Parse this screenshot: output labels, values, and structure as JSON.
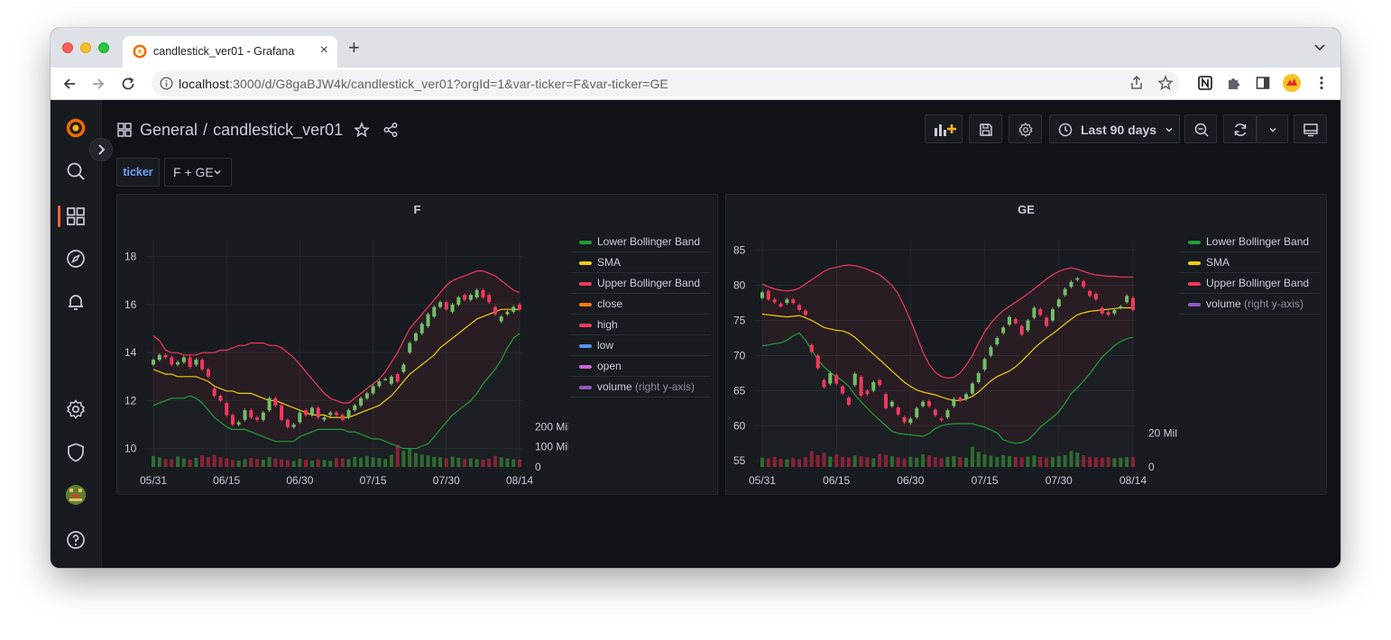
{
  "browser": {
    "tab_title": "candlestick_ver01 - Grafana",
    "url_host": "localhost",
    "url_rest": ":3000/d/G8gaBJW4k/candlestick_ver01?orgId=1&var-ticker=F&var-ticker=GE"
  },
  "dashboard": {
    "breadcrumb_folder": "General",
    "breadcrumb_separator": "/",
    "breadcrumb_title": "candlestick_ver01",
    "time_range": "Last 90 days",
    "variable_label": "ticker",
    "variable_value": "F + GE"
  },
  "colors": {
    "lower_band": "#1f9f3a",
    "sma": "#f2cc0c",
    "upper_band": "#f2385e",
    "close": "#ff780a",
    "high": "#f2385e",
    "low": "#5794f2",
    "open": "#c763d6",
    "volume": "#8f5bbf",
    "candle_up": "#73bf69",
    "candle_down": "#f2385e"
  },
  "panels": [
    {
      "title": "F",
      "legend": [
        {
          "label": "Lower Bollinger Band",
          "suffix": "",
          "color": "#1f9f3a"
        },
        {
          "label": "SMA",
          "suffix": "",
          "color": "#f2cc0c"
        },
        {
          "label": "Upper Bollinger Band",
          "suffix": "",
          "color": "#f2385e"
        },
        {
          "label": "close",
          "suffix": "",
          "color": "#ff780a"
        },
        {
          "label": "high",
          "suffix": "",
          "color": "#f2385e"
        },
        {
          "label": "low",
          "suffix": "",
          "color": "#5794f2"
        },
        {
          "label": "open",
          "suffix": "",
          "color": "#c763d6"
        },
        {
          "label": "volume",
          "suffix": " (right y-axis)",
          "color": "#8f5bbf"
        }
      ]
    },
    {
      "title": "GE",
      "legend": [
        {
          "label": "Lower Bollinger Band",
          "suffix": "",
          "color": "#1f9f3a"
        },
        {
          "label": "SMA",
          "suffix": "",
          "color": "#f2cc0c"
        },
        {
          "label": "Upper Bollinger Band",
          "suffix": "",
          "color": "#f2385e"
        },
        {
          "label": "volume",
          "suffix": " (right y-axis)",
          "color": "#8f5bbf"
        }
      ]
    }
  ],
  "chart_data": [
    {
      "type": "candlestick",
      "title": "F",
      "x_tick_labels": [
        "05/31",
        "06/15",
        "06/30",
        "07/15",
        "07/30",
        "08/14"
      ],
      "y_ticks": [
        10,
        12,
        14,
        16,
        18
      ],
      "y_tick_labels": [
        "10",
        "12",
        "14",
        "16",
        "18"
      ],
      "ylim": [
        9.2,
        18.7
      ],
      "right_y_ticks": [
        0,
        100,
        200
      ],
      "right_y_tick_labels": [
        "0",
        "100 Mil",
        "200 Mil"
      ],
      "right_ylim": [
        0,
        220
      ],
      "days": 61,
      "series": [
        {
          "name": "Upper Bollinger Band",
          "values": [
            14.7,
            14.5,
            14.1,
            14,
            14,
            13.9,
            13.9,
            13.9,
            14,
            14,
            14,
            14.1,
            14.1,
            14.2,
            14.3,
            14.3,
            14.4,
            14.4,
            14.4,
            14.3,
            14.3,
            14.2,
            14,
            13.8,
            13.5,
            13.2,
            12.9,
            12.6,
            12.3,
            12.1,
            12.0,
            11.9,
            11.9,
            12.1,
            12.3,
            12.5,
            12.7,
            12.9,
            13.2,
            13.6,
            14.0,
            14.5,
            15.0,
            15.3,
            15.6,
            15.9,
            16.2,
            16.5,
            16.8,
            17.0,
            17.1,
            17.2,
            17.3,
            17.4,
            17.4,
            17.3,
            17.2,
            17.0,
            16.8,
            16.6,
            16.5
          ]
        },
        {
          "name": "SMA",
          "values": [
            13.3,
            13.2,
            13.1,
            13.1,
            13.0,
            13.0,
            13.0,
            13.0,
            12.9,
            12.8,
            12.6,
            12.5,
            12.4,
            12.4,
            12.3,
            12.3,
            12.3,
            12.2,
            12.1,
            12.0,
            12.0,
            11.9,
            11.8,
            11.7,
            11.6,
            11.5,
            11.4,
            11.4,
            11.4,
            11.3,
            11.3,
            11.3,
            11.3,
            11.4,
            11.5,
            11.6,
            11.7,
            11.8,
            12.0,
            12.2,
            12.5,
            12.8,
            13.1,
            13.3,
            13.5,
            13.7,
            13.9,
            14.2,
            14.4,
            14.6,
            14.8,
            15.0,
            15.2,
            15.4,
            15.5,
            15.6,
            15.7,
            15.8,
            15.8,
            15.8,
            15.8
          ]
        },
        {
          "name": "Lower Bollinger Band",
          "values": [
            11.8,
            11.9,
            12.0,
            12.1,
            12.1,
            12.1,
            12.2,
            12.1,
            11.9,
            11.6,
            11.3,
            11.1,
            10.9,
            10.8,
            10.8,
            10.8,
            10.7,
            10.6,
            10.5,
            10.4,
            10.3,
            10.3,
            10.3,
            10.3,
            10.5,
            10.6,
            10.7,
            10.8,
            10.8,
            10.8,
            10.8,
            10.8,
            10.7,
            10.7,
            10.6,
            10.5,
            10.4,
            10.4,
            10.3,
            10.2,
            10.1,
            10.0,
            10.0,
            10.0,
            10.1,
            10.2,
            10.5,
            10.8,
            11.1,
            11.4,
            11.6,
            11.8,
            12.0,
            12.3,
            12.7,
            13.0,
            13.3,
            13.7,
            14.2,
            14.6,
            14.8
          ]
        },
        {
          "name": "close",
          "values": [
            13.7,
            13.9,
            13.8,
            13.5,
            13.6,
            13.8,
            13.4,
            13.7,
            13.3,
            13.0,
            12.2,
            12.0,
            11.4,
            11.0,
            11.1,
            11.6,
            11.3,
            11.2,
            11.5,
            12.1,
            11.8,
            11.2,
            10.9,
            11.0,
            11.5,
            11.4,
            11.7,
            11.3,
            11.3,
            11.5,
            11.4,
            11.2,
            11.6,
            11.8,
            12.1,
            12.3,
            12.6,
            12.8,
            12.9,
            13.0,
            12.8,
            13.5,
            14.4,
            14.8,
            15.2,
            15.6,
            15.9,
            16.1,
            15.8,
            16.0,
            16.3,
            16.2,
            16.4,
            16.6,
            16.3,
            16.1,
            15.6,
            15.5,
            15.7,
            15.9,
            15.8
          ]
        },
        {
          "name": "open",
          "values": [
            13.5,
            13.7,
            13.9,
            13.8,
            13.5,
            13.6,
            13.8,
            13.5,
            13.7,
            13.3,
            12.5,
            12.2,
            11.9,
            11.4,
            11.0,
            11.2,
            11.6,
            11.3,
            11.2,
            11.6,
            12.1,
            11.8,
            11.2,
            10.9,
            11.1,
            11.6,
            11.4,
            11.7,
            11.2,
            11.4,
            11.5,
            11.4,
            11.3,
            11.6,
            11.8,
            12.1,
            12.3,
            12.6,
            12.9,
            12.7,
            13.1,
            13.2,
            14.0,
            14.5,
            14.8,
            15.1,
            15.5,
            15.9,
            16.1,
            15.7,
            16.0,
            16.4,
            16.2,
            16.3,
            16.6,
            16.4,
            15.9,
            15.3,
            15.6,
            15.7,
            16.0
          ]
        },
        {
          "name": "volume",
          "values": [
            55,
            48,
            40,
            38,
            52,
            42,
            36,
            45,
            58,
            50,
            60,
            48,
            42,
            35,
            32,
            38,
            45,
            40,
            36,
            50,
            42,
            38,
            34,
            30,
            40,
            36,
            32,
            38,
            34,
            30,
            44,
            42,
            38,
            50,
            46,
            55,
            48,
            44,
            40,
            60,
            110,
            80,
            95,
            70,
            62,
            58,
            50,
            48,
            44,
            52,
            46,
            40,
            42,
            38,
            36,
            40,
            55,
            48,
            42,
            38,
            36
          ]
        }
      ]
    },
    {
      "type": "candlestick",
      "title": "GE",
      "x_tick_labels": [
        "05/31",
        "06/15",
        "06/30",
        "07/15",
        "07/30",
        "08/14"
      ],
      "y_ticks": [
        55,
        60,
        65,
        70,
        75,
        80,
        85
      ],
      "y_tick_labels": [
        "55",
        "60",
        "65",
        "70",
        "75",
        "80",
        "85"
      ],
      "ylim": [
        54,
        86.5
      ],
      "right_y_ticks": [
        0,
        20
      ],
      "right_y_tick_labels": [
        "0",
        "20 Mil"
      ],
      "right_ylim": [
        0,
        22
      ],
      "days": 61,
      "series": [
        {
          "name": "Upper Bollinger Band",
          "values": [
            80.2,
            79.8,
            79.5,
            79.3,
            79.2,
            79.3,
            79.6,
            80.2,
            80.8,
            81.4,
            82.0,
            82.4,
            82.6,
            82.8,
            82.9,
            82.8,
            82.6,
            82.3,
            81.9,
            81.5,
            80.8,
            80.0,
            78.8,
            77.0,
            75.0,
            72.8,
            70.5,
            68.8,
            67.6,
            67.0,
            66.8,
            66.9,
            67.5,
            68.6,
            70.0,
            71.8,
            73.4,
            74.6,
            75.6,
            76.4,
            77.0,
            77.6,
            78.2,
            78.8,
            79.5,
            80.2,
            80.9,
            81.5,
            82.0,
            82.3,
            82.5,
            82.3,
            82.0,
            81.7,
            81.5,
            81.4,
            81.3,
            81.3,
            81.2,
            81.2,
            81.2
          ]
        },
        {
          "name": "SMA",
          "values": [
            75.9,
            75.8,
            75.7,
            75.6,
            75.5,
            75.6,
            75.7,
            75.4,
            75.0,
            74.5,
            74.0,
            73.8,
            73.6,
            73.5,
            73.2,
            72.6,
            71.8,
            71.0,
            70.2,
            69.4,
            68.6,
            67.8,
            67.0,
            66.2,
            65.6,
            65.1,
            64.8,
            64.6,
            64.4,
            64.1,
            63.8,
            63.6,
            63.6,
            63.8,
            64.2,
            64.8,
            65.6,
            66.4,
            67.0,
            67.4,
            67.8,
            68.4,
            69.2,
            70.1,
            71.0,
            71.8,
            72.5,
            73.1,
            73.8,
            74.5,
            75.2,
            75.8,
            76.1,
            76.3,
            76.4,
            76.5,
            76.6,
            76.7,
            76.8,
            76.8,
            76.8
          ]
        },
        {
          "name": "Lower Bollinger Band",
          "values": [
            71.4,
            71.5,
            71.7,
            71.8,
            72.2,
            72.8,
            73.2,
            72.2,
            70.8,
            69.4,
            68.4,
            67.6,
            67.0,
            66.4,
            65.6,
            64.4,
            63.4,
            62.5,
            61.6,
            60.8,
            60.0,
            59.2,
            58.9,
            58.8,
            58.7,
            58.6,
            58.5,
            58.9,
            59.6,
            60.0,
            60.2,
            60.3,
            60.3,
            60.3,
            60.3,
            60.0,
            59.8,
            59.4,
            59.0,
            58.0,
            57.7,
            57.5,
            57.6,
            58.0,
            58.8,
            59.8,
            60.5,
            61.2,
            62.0,
            63.2,
            64.6,
            65.4,
            66.4,
            67.4,
            68.6,
            69.8,
            70.6,
            71.4,
            72.0,
            72.4,
            72.6
          ]
        },
        {
          "name": "close",
          "values": [
            79.0,
            78.0,
            77.6,
            77.0,
            78.0,
            77.5,
            76.5,
            75.8,
            70.5,
            68.2,
            65.5,
            67.5,
            66.0,
            64.6,
            63.0,
            67.4,
            64.3,
            64.5,
            66.2,
            65.8,
            62.5,
            63.4,
            61.6,
            60.5,
            61.0,
            62.5,
            63.4,
            62.8,
            61.5,
            60.8,
            62.2,
            63.8,
            63.6,
            64.5,
            66.0,
            67.5,
            69.5,
            71.2,
            72.5,
            74.0,
            75.5,
            74.6,
            73.0,
            75.0,
            76.8,
            75.8,
            74.2,
            76.6,
            78.0,
            79.5,
            80.5,
            81.0,
            79.8,
            78.5,
            78.0,
            76.0,
            75.8,
            76.5,
            77.0,
            78.5,
            76.5
          ]
        },
        {
          "name": "open",
          "values": [
            78.2,
            79.2,
            78.0,
            77.4,
            77.5,
            78.0,
            77.2,
            76.4,
            71.5,
            70.0,
            66.5,
            66.0,
            67.2,
            65.6,
            64.0,
            65.8,
            67.0,
            65.0,
            65.0,
            66.5,
            64.5,
            62.8,
            62.6,
            61.2,
            60.4,
            61.2,
            62.8,
            63.5,
            62.3,
            61.0,
            61.2,
            62.8,
            64.0,
            63.8,
            64.6,
            66.2,
            68.0,
            70.0,
            71.6,
            73.2,
            74.4,
            75.2,
            74.2,
            73.6,
            75.4,
            76.6,
            75.4,
            75.0,
            77.0,
            78.6,
            79.8,
            80.8,
            80.6,
            79.2,
            78.8,
            76.8,
            76.2,
            76.0,
            76.8,
            77.6,
            78.2
          ]
        },
        {
          "name": "volume",
          "values": [
            5.5,
            5.0,
            6.0,
            4.8,
            4.5,
            5.2,
            4.6,
            5.8,
            9.5,
            7.0,
            8.5,
            6.2,
            7.5,
            6.0,
            5.6,
            6.8,
            6.5,
            5.8,
            5.2,
            7.8,
            7.2,
            6.4,
            5.6,
            5.0,
            6.0,
            5.5,
            7.5,
            6.8,
            5.8,
            5.2,
            6.0,
            6.5,
            5.8,
            5.5,
            12.0,
            9.0,
            7.5,
            6.8,
            6.0,
            7.0,
            6.5,
            6.0,
            5.6,
            6.2,
            6.8,
            6.0,
            5.5,
            5.8,
            6.5,
            7.0,
            9.5,
            8.5,
            7.0,
            6.0,
            5.8,
            5.5,
            6.0,
            5.2,
            5.5,
            5.8,
            6.0
          ]
        }
      ]
    }
  ]
}
